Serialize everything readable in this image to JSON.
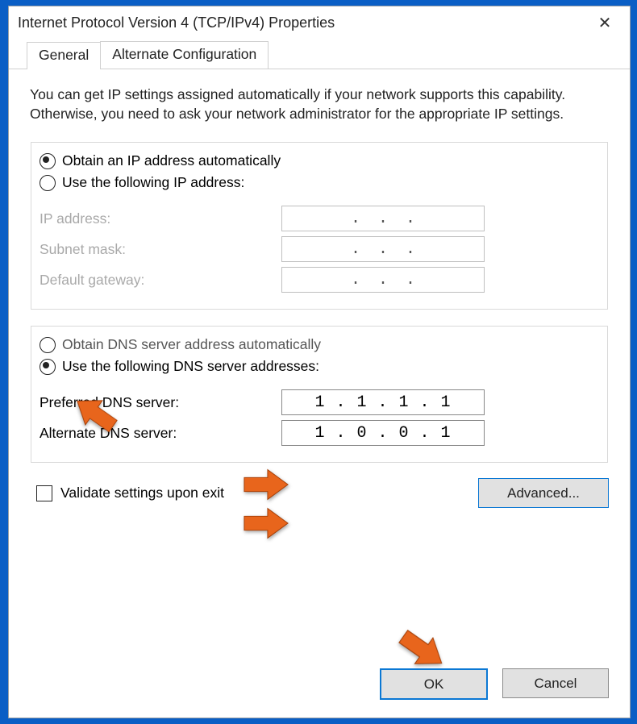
{
  "window": {
    "title": "Internet Protocol Version 4 (TCP/IPv4) Properties"
  },
  "tabs": {
    "general": "General",
    "alternate": "Alternate Configuration"
  },
  "description": "You can get IP settings assigned automatically if your network supports this capability. Otherwise, you need to ask your network administrator for the appropriate IP settings.",
  "ip": {
    "radio_auto": "Obtain an IP address automatically",
    "radio_manual": "Use the following IP address:",
    "labels": {
      "address": "IP address:",
      "subnet": "Subnet mask:",
      "gateway": "Default gateway:"
    },
    "values": {
      "address": "",
      "subnet": "",
      "gateway": ""
    },
    "selected": "auto"
  },
  "dns": {
    "radio_auto": "Obtain DNS server address automatically",
    "radio_manual": "Use the following DNS server addresses:",
    "labels": {
      "preferred": "Preferred DNS server:",
      "alternate": "Alternate DNS server:"
    },
    "values": {
      "preferred": "1 . 1 . 1 . 1",
      "alternate": "1 . 0 . 0 . 1"
    },
    "selected": "manual"
  },
  "validate_label": "Validate settings upon exit",
  "validate_checked": false,
  "buttons": {
    "advanced": "Advanced...",
    "ok": "OK",
    "cancel": "Cancel"
  }
}
